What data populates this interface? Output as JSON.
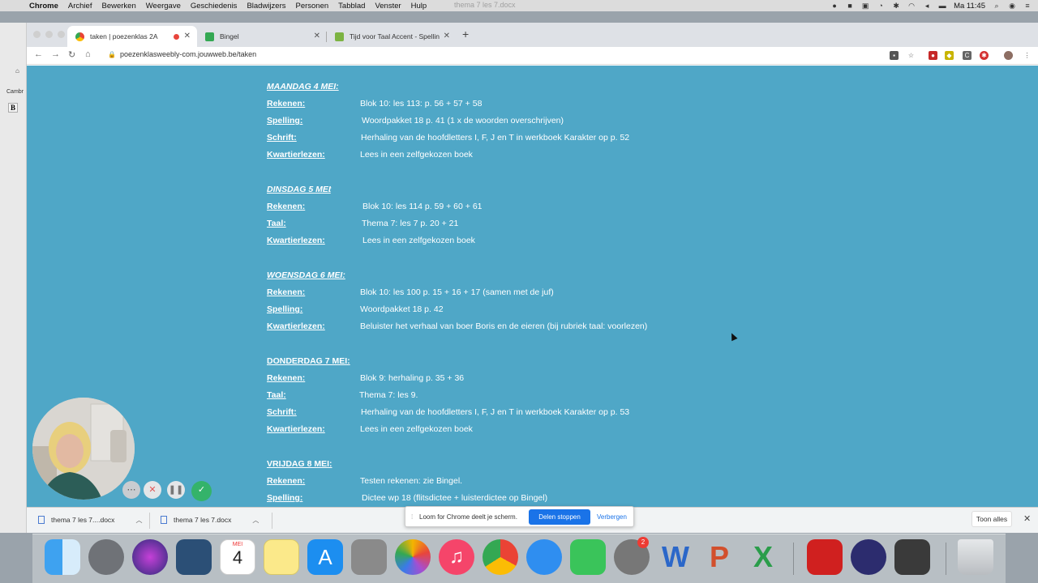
{
  "menubar": {
    "app": "Chrome",
    "menus": [
      "Archief",
      "Bewerken",
      "Weergave",
      "Geschiedenis",
      "Bladwijzers",
      "Personen",
      "Tabblad",
      "Venster",
      "Hulp"
    ],
    "doc_title": "thema 7 les 7.docx",
    "clock": "Ma 11:45"
  },
  "background_doc": {
    "font_field": "Cambr",
    "bold_label": "B"
  },
  "tabs": [
    {
      "label": "taken | poezenklas 2A"
    },
    {
      "label": "Bingel"
    },
    {
      "label": "Tijd voor Taal Accent - Spellin"
    }
  ],
  "toolbar": {
    "url": "poezenklasweebly-com.jouwweb.be/taken"
  },
  "schedule": {
    "maandag": {
      "title": "MAANDAG 4 MEI:",
      "rows": [
        {
          "label": "Rekenen:",
          "value": "Blok 10: les 113: p. 56 + 57 + 58"
        },
        {
          "label": "Spelling:",
          "value": "Woordpakket 18 p. 41 (1 x de woorden overschrijven)"
        },
        {
          "label": "Schrift:",
          "value": "Herhaling van de hoofdletters I, F, J en T in werkboek Karakter op p. 52"
        },
        {
          "label": "Kwartierlezen:",
          "value": "Lees in een zelfgekozen boek"
        }
      ]
    },
    "dinsdag": {
      "title": "DINSDAG 5 MEI",
      "title_suffix": ":",
      "rows": [
        {
          "label": "Rekenen:",
          "value": "Blok 10: les 114 p. 59 + 60 + 61"
        },
        {
          "label": "Taal:",
          "value": "Thema 7: les 7 p. 20 + 21"
        },
        {
          "label": "Kwartierlezen:",
          "value": "Lees in een zelfgekozen boek"
        }
      ]
    },
    "woensdag": {
      "title": "WOENSDAG 6 MEI:",
      "rows": [
        {
          "label": "Rekenen:",
          "value": "Blok 10: les 100 p. 15 + 16 + 17 (samen met de juf)"
        },
        {
          "label": "Spelling:",
          "value": "Woordpakket 18 p. 42"
        },
        {
          "label": "Kwartierlezen:",
          "value": "Beluister het verhaal van boer Boris en de eieren (bij rubriek taal: voorlezen)"
        }
      ]
    },
    "donderdag": {
      "title": "DONDERDAG 7 MEI:",
      "rows": [
        {
          "label": "Rekenen:",
          "value": "Blok 9: herhaling p. 35 + 36"
        },
        {
          "label": "Taal:",
          "value": "Thema 7: les 9."
        },
        {
          "label": "Schrift:",
          "value": "Herhaling van de hoofdletters I, F, J en T in werkboek Karakter op p. 53"
        },
        {
          "label": "Kwartierlezen:",
          "value": "Lees in een zelfgekozen boek"
        }
      ]
    },
    "vrijdag": {
      "title": "VRIJDAG 8 MEI:",
      "rows": [
        {
          "label": "Rekenen:",
          "value": "Testen rekenen: zie Bingel."
        },
        {
          "label": "Spelling:",
          "value": "Dictee wp 18 (flitsdictee + luisterdictee op Bingel)"
        }
      ]
    }
  },
  "downloads": {
    "items": [
      "thema 7 les 7....docx",
      "thema 7 les 7.docx"
    ],
    "show_all": "Toon alles"
  },
  "loom": {
    "message": "Loom for Chrome deelt je scherm.",
    "stop_label": "Delen stoppen",
    "hide_label": "Verbergen"
  },
  "dock": {
    "calendar_month": "MEI",
    "calendar_day": "4",
    "badge_count": "2"
  },
  "colors": {
    "page_bg": "#4fa7c7",
    "loom_button": "#1a73e8",
    "record_dot": "#e8453c"
  }
}
